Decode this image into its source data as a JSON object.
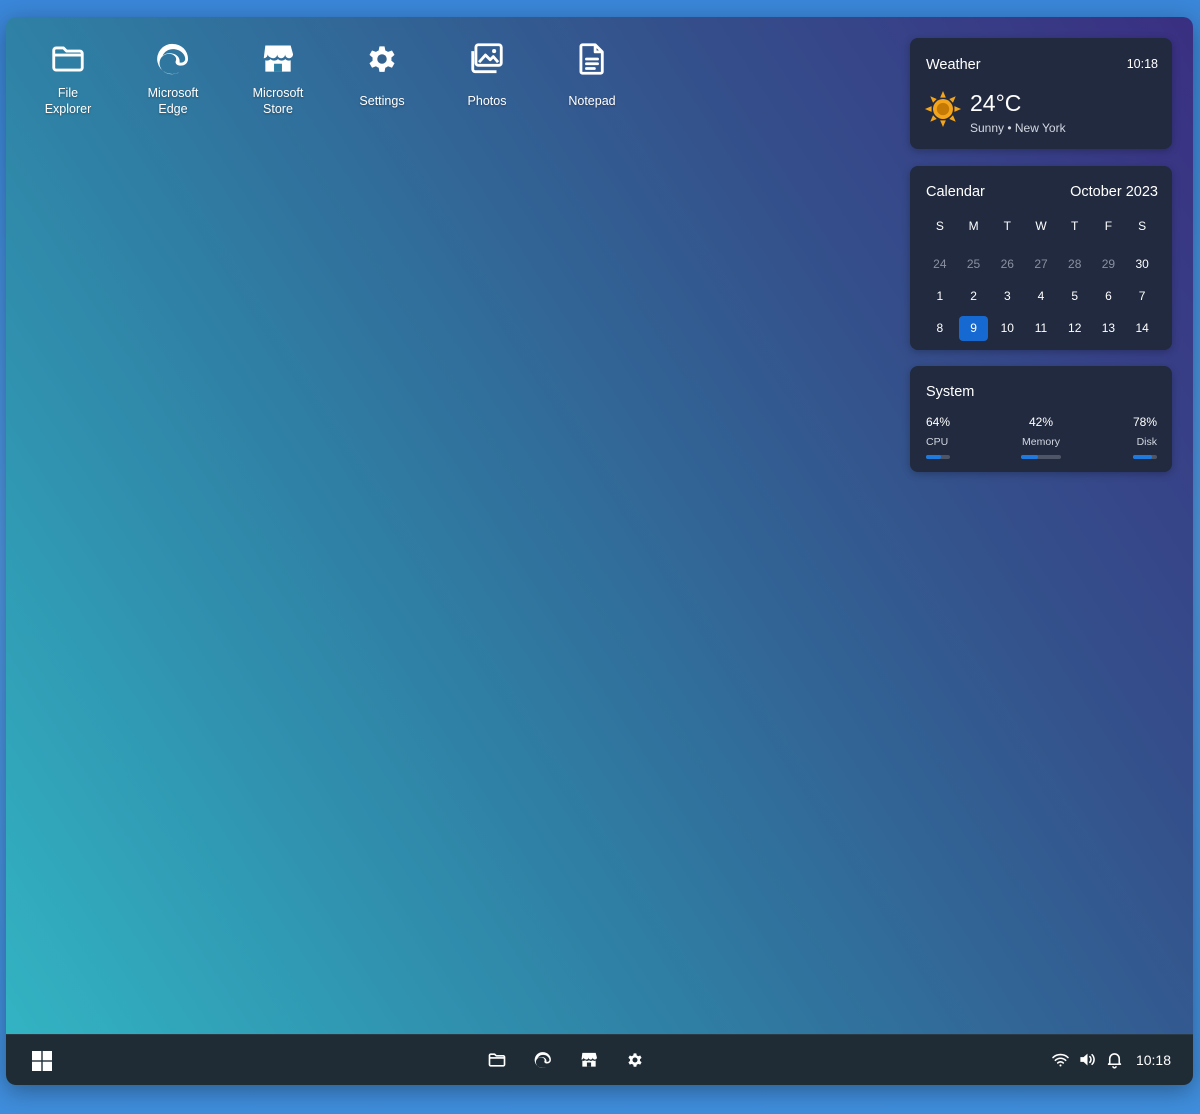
{
  "desktop_icons": [
    {
      "label": "File Explorer",
      "icon": "folder-icon"
    },
    {
      "label": "Microsoft Edge",
      "icon": "edge-icon"
    },
    {
      "label": "Microsoft Store",
      "icon": "store-icon"
    },
    {
      "label": "Settings",
      "icon": "gear-icon"
    },
    {
      "label": "Photos",
      "icon": "photos-icon"
    },
    {
      "label": "Notepad",
      "icon": "notepad-icon"
    }
  ],
  "weather": {
    "title": "Weather",
    "time": "10:18",
    "temperature": "24°C",
    "condition": "Sunny • New York",
    "icon": "sun-icon",
    "icon_color": "#f4a51b"
  },
  "calendar": {
    "title": "Calendar",
    "month": "October 2023",
    "weekdays": [
      "S",
      "M",
      "T",
      "W",
      "T",
      "F",
      "S"
    ],
    "days": [
      {
        "d": "24",
        "muted": true
      },
      {
        "d": "25",
        "muted": true
      },
      {
        "d": "26",
        "muted": true
      },
      {
        "d": "27",
        "muted": true
      },
      {
        "d": "28",
        "muted": true
      },
      {
        "d": "29",
        "muted": true
      },
      {
        "d": "30",
        "muted": false
      },
      {
        "d": "1"
      },
      {
        "d": "2"
      },
      {
        "d": "3"
      },
      {
        "d": "4"
      },
      {
        "d": "5"
      },
      {
        "d": "6"
      },
      {
        "d": "7"
      },
      {
        "d": "8"
      },
      {
        "d": "9",
        "today": true
      },
      {
        "d": "10"
      },
      {
        "d": "11"
      },
      {
        "d": "12"
      },
      {
        "d": "13"
      },
      {
        "d": "14"
      }
    ],
    "today_color": "#1769d2"
  },
  "system": {
    "title": "System",
    "items": [
      {
        "name": "CPU",
        "value": "64%",
        "fill": 0.64
      },
      {
        "name": "Memory",
        "value": "42%",
        "fill": 0.42
      },
      {
        "name": "Disk",
        "value": "78%",
        "fill": 0.78
      }
    ],
    "accent": "#1f7ae0"
  },
  "taskbar": {
    "start_icon": "windows-logo-icon",
    "pinned": [
      "folder-icon",
      "edge-icon",
      "store-icon",
      "gear-icon"
    ],
    "tray": [
      "wifi-icon",
      "volume-icon",
      "bell-icon"
    ],
    "clock": "10:18"
  }
}
